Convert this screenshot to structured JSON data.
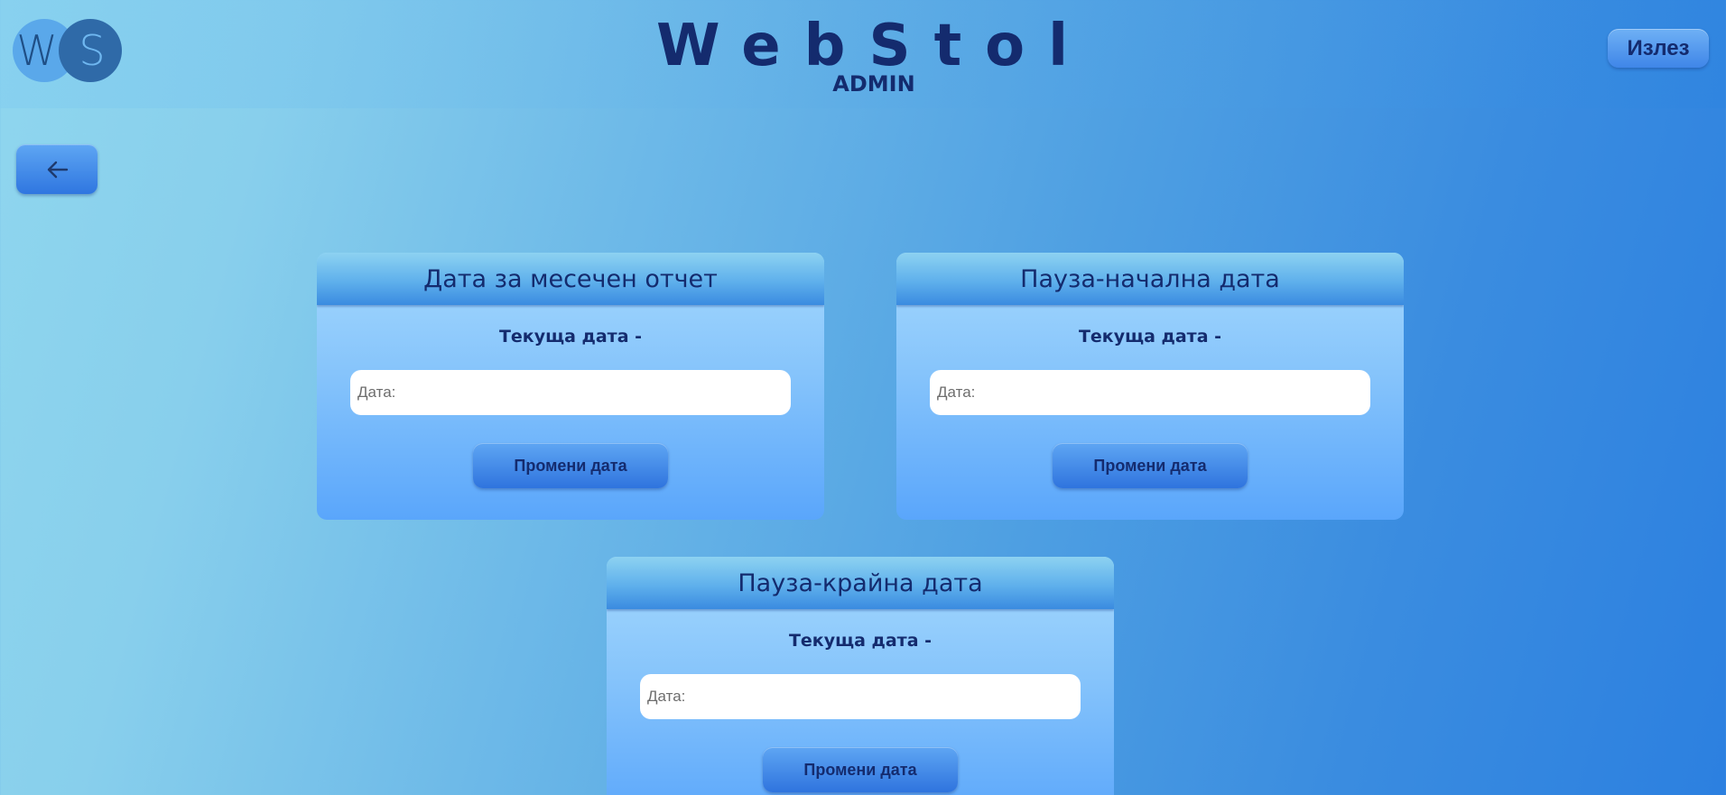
{
  "header": {
    "logo": {
      "letters": "WS",
      "color_left": "#5aa8ea",
      "color_right": "#2f6aa8"
    },
    "title": "WebStol",
    "subtitle": "ADMIN",
    "logout_label": "Излез"
  },
  "nav": {
    "back_icon": "arrow-left-icon"
  },
  "cards": [
    {
      "title": "Дата за месечен отчет",
      "current_date_label": "Текуща дата -",
      "input_placeholder": "Дата:",
      "input_value": "",
      "button_label": "Промени дата"
    },
    {
      "title": "Пауза-начална дата",
      "current_date_label": "Текуща дата -",
      "input_placeholder": "Дата:",
      "input_value": "",
      "button_label": "Промени дата"
    },
    {
      "title": "Пауза-крайна дата",
      "current_date_label": "Текуща дата -",
      "input_placeholder": "Дата:",
      "input_value": "",
      "button_label": "Промени дата"
    }
  ],
  "colors": {
    "text_primary": "#142b6e",
    "button_top": "#5ea6f3",
    "button_bottom": "#2f74de",
    "background_left": "#8fd6ee",
    "background_right": "#2c80e0"
  }
}
